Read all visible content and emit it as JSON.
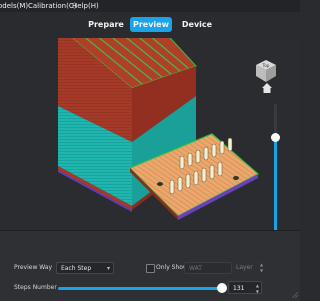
{
  "menubar": {
    "items": [
      "odels(M)",
      "Calibration(C)",
      "Help(H)"
    ]
  },
  "tabs": [
    {
      "label": "Prepare",
      "active": false
    },
    {
      "label": "Preview",
      "active": true
    },
    {
      "label": "Device",
      "active": false
    }
  ],
  "colors": {
    "accent": "#1aa3e8",
    "wall_red": "#a63a28",
    "wall_teal": "#1fb6b0",
    "infill_orange": "#e8a36a",
    "support_green": "#3fbf3f"
  },
  "nav_cube": {
    "label": "Top"
  },
  "layer_slider": {
    "value_fraction": 0.72
  },
  "panel": {
    "preview_way_label": "Preview Way",
    "preview_way_value": "Each Step",
    "only_show_label": "Only Show",
    "only_show_value": "WAT",
    "layer_label": "Layer",
    "steps_number_label": "Steps Number",
    "steps_number_value": "131",
    "steps_fraction": 0.96
  }
}
